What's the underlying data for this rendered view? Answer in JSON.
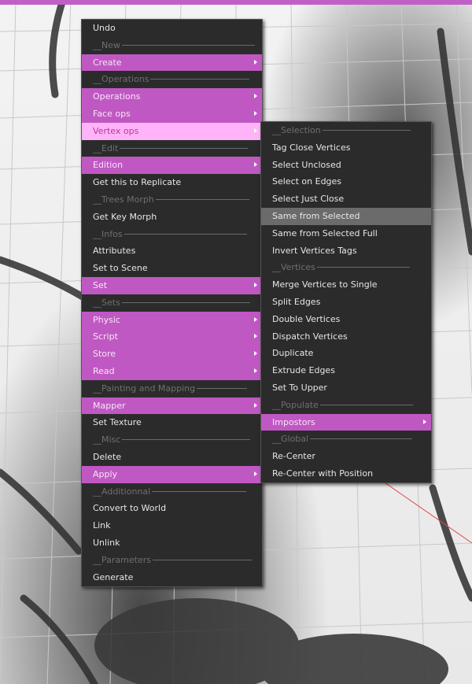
{
  "colors": {
    "submenu_bg": "#c058c3",
    "active_bg": "#ffb3f8",
    "active_text": "#c2339e",
    "hover_bg": "#6b6b6b",
    "menu_bg": "#2b2b2b",
    "separator_text": "#6f6f6f"
  },
  "main_menu": {
    "items": [
      {
        "label": "Undo",
        "type": "action"
      },
      {
        "label": "__New",
        "type": "separator"
      },
      {
        "label": "Create",
        "type": "submenu"
      },
      {
        "label": "__Operations",
        "type": "separator"
      },
      {
        "label": "Operations",
        "type": "submenu"
      },
      {
        "label": "Face ops",
        "type": "submenu"
      },
      {
        "label": "Vertex ops",
        "type": "submenu",
        "state": "active"
      },
      {
        "label": "__Edit",
        "type": "separator"
      },
      {
        "label": "Edition",
        "type": "submenu"
      },
      {
        "label": "Get this to Replicate",
        "type": "action"
      },
      {
        "label": "__Trees Morph",
        "type": "separator"
      },
      {
        "label": "Get Key Morph",
        "type": "action"
      },
      {
        "label": "__Infos",
        "type": "separator"
      },
      {
        "label": "Attributes",
        "type": "action"
      },
      {
        "label": "Set to Scene",
        "type": "action"
      },
      {
        "label": "Set",
        "type": "submenu"
      },
      {
        "label": "__Sets",
        "type": "separator"
      },
      {
        "label": "Physic",
        "type": "submenu"
      },
      {
        "label": "Script",
        "type": "submenu"
      },
      {
        "label": "Store",
        "type": "submenu"
      },
      {
        "label": "Read",
        "type": "submenu"
      },
      {
        "label": "__Painting and Mapping",
        "type": "separator"
      },
      {
        "label": "Mapper",
        "type": "submenu"
      },
      {
        "label": "Set Texture",
        "type": "action"
      },
      {
        "label": "__Misc",
        "type": "separator"
      },
      {
        "label": "Delete",
        "type": "action"
      },
      {
        "label": "Apply",
        "type": "submenu"
      },
      {
        "label": "__Additionnal",
        "type": "separator"
      },
      {
        "label": "Convert to World",
        "type": "action"
      },
      {
        "label": "Link",
        "type": "action"
      },
      {
        "label": "Unlink",
        "type": "action"
      },
      {
        "label": "__Parameters",
        "type": "separator"
      },
      {
        "label": "Generate",
        "type": "action"
      }
    ]
  },
  "sub_menu": {
    "items": [
      {
        "label": "__Selection",
        "type": "separator"
      },
      {
        "label": "Tag Close Vertices",
        "type": "action"
      },
      {
        "label": "Select Unclosed",
        "type": "action"
      },
      {
        "label": "Select on Edges",
        "type": "action"
      },
      {
        "label": "Select Just Close",
        "type": "action"
      },
      {
        "label": "Same from Selected",
        "type": "action",
        "state": "hover"
      },
      {
        "label": "Same from Selected Full",
        "type": "action"
      },
      {
        "label": "Invert Vertices Tags",
        "type": "action"
      },
      {
        "label": "__Vertices",
        "type": "separator"
      },
      {
        "label": "Merge Vertices to Single",
        "type": "action"
      },
      {
        "label": "Split Edges",
        "type": "action"
      },
      {
        "label": "Double Vertices",
        "type": "action"
      },
      {
        "label": "Dispatch Vertices",
        "type": "action"
      },
      {
        "label": "Duplicate",
        "type": "action"
      },
      {
        "label": "Extrude Edges",
        "type": "action"
      },
      {
        "label": "Set To Upper",
        "type": "action"
      },
      {
        "label": "__Populate",
        "type": "separator"
      },
      {
        "label": "Impostors",
        "type": "submenu"
      },
      {
        "label": "__Global",
        "type": "separator"
      },
      {
        "label": "Re-Center",
        "type": "action"
      },
      {
        "label": "Re-Center with Position",
        "type": "action"
      }
    ]
  }
}
